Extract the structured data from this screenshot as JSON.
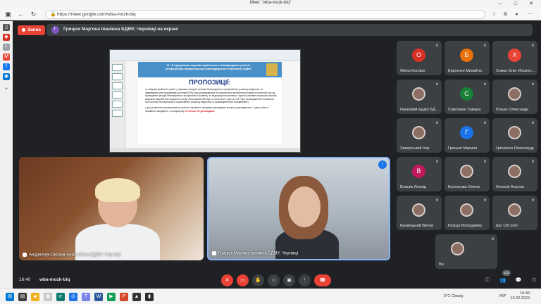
{
  "browser": {
    "tab_title": "Meet: \"wba-mozk-biq\"",
    "url": "https://meet.google.com/wba-mozk-biq"
  },
  "meet": {
    "recording_label": "Запис",
    "presenter_initial": "Г",
    "presenter_text": "Грицюк Мар'яна Іванівна БДМУ, Чернівці на екрані",
    "slide": {
      "banner_text": "IIІ - й підсумкова науково-практична з міжнародною участю конференція професорсько-викладацького персоналу БДМУ",
      "heading": "ПРОПОЗИЦІЇ:",
      "para1": "• у напрямі прийняття участі у наукових заходах системи безперервного професійного розвитку медичних та фармацевтичних працівників (системи БПР) слід дотримуватися Положення про запобігання конфлікту інтересів під час проведення заходів безперервного професійного розвитку та недопущення реклами / скритої реклами лікарських засобів, медичних виробів або медичних послуг (Постанова КМУ від 14 липня 2021 року № 725 «Про затвердження Положення про систему безперервного професійного розвитку медичних та фармацевтичних працівників»);",
      "para2_prefix": "• для уникнення перевантаження роботи секційного засідання враховувати кількість доповідачів на 1 день роботи секційного засідання – із розрахунку ",
      "para2_red": "не більше 20 доповідачів."
    },
    "videos": [
      {
        "name": "Андрейчук Оксана Анатоліївна БДМУ, Чернівці"
      },
      {
        "name": "Грицюк Мар'яна Іванівна БДМУ, Чернівці"
      }
    ],
    "participants": [
      {
        "initial": "О",
        "name": "Olena Korotun",
        "color": "#d93025"
      },
      {
        "initial": "Б",
        "name": "Братенко Михайло",
        "color": "#e8710a"
      },
      {
        "initial": "Х",
        "name": "Хомко Олег Йосипович",
        "color": "#ea4335"
      },
      {
        "initial": "",
        "name": "Науковий відділ БДМУ",
        "color": "#5f6368"
      },
      {
        "initial": "С",
        "name": "Сорохман Тамара",
        "color": "#188038"
      },
      {
        "initial": "",
        "name": "Юзько Олександр",
        "color": "#5f6368"
      },
      {
        "initial": "",
        "name": "Заморський Ігор",
        "color": "#5f6368"
      },
      {
        "initial": "Г",
        "name": "Гресько Марина",
        "color": "#1a73e8"
      },
      {
        "initial": "",
        "name": "Цигикало Олександр",
        "color": "#5f6368"
      },
      {
        "initial": "В",
        "name": "Власик Леонід",
        "color": "#c2185b"
      },
      {
        "initial": "",
        "name": "Колоскова Олена",
        "color": "#5f6368"
      },
      {
        "initial": "",
        "name": "Антонів Альона",
        "color": "#5f6368"
      },
      {
        "initial": "",
        "name": "Кривецький Віктор",
        "color": "#5f6368"
      },
      {
        "initial": "",
        "name": "Безрук Володимир",
        "color": "#5f6368"
      },
      {
        "initial": "",
        "name": "Ще 126 осіб",
        "color": "#5f6368"
      },
      {
        "initial": "",
        "name": "Ви",
        "color": "#5f6368"
      }
    ],
    "controls": {
      "time": "16:40",
      "meeting_code": "wba-mozk-biq",
      "people_count": "143"
    }
  },
  "taskbar": {
    "weather": "2°C Cloudy",
    "lang": "УКР",
    "time": "16:40",
    "date": "13.02.2023"
  }
}
